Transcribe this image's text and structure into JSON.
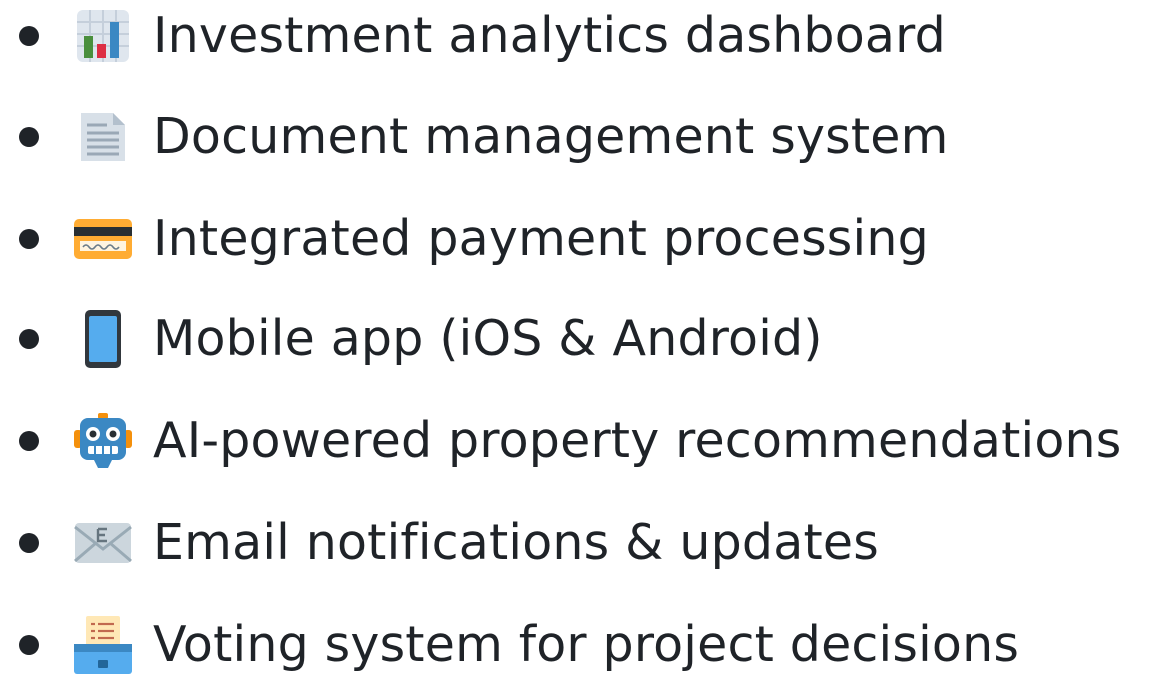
{
  "features": [
    {
      "icon": "bar-chart-icon",
      "label": "Investment analytics dashboard"
    },
    {
      "icon": "document-icon",
      "label": "Document management system"
    },
    {
      "icon": "credit-card-icon",
      "label": "Integrated payment processing"
    },
    {
      "icon": "mobile-phone-icon",
      "label": "Mobile app (iOS & Android)"
    },
    {
      "icon": "robot-icon",
      "label": "AI-powered property recommendations"
    },
    {
      "icon": "email-icon",
      "label": "Email notifications & updates"
    },
    {
      "icon": "ballot-box-icon",
      "label": "Voting system for project decisions"
    }
  ],
  "colors": {
    "text": "#1f2328",
    "background": "#ffffff"
  }
}
